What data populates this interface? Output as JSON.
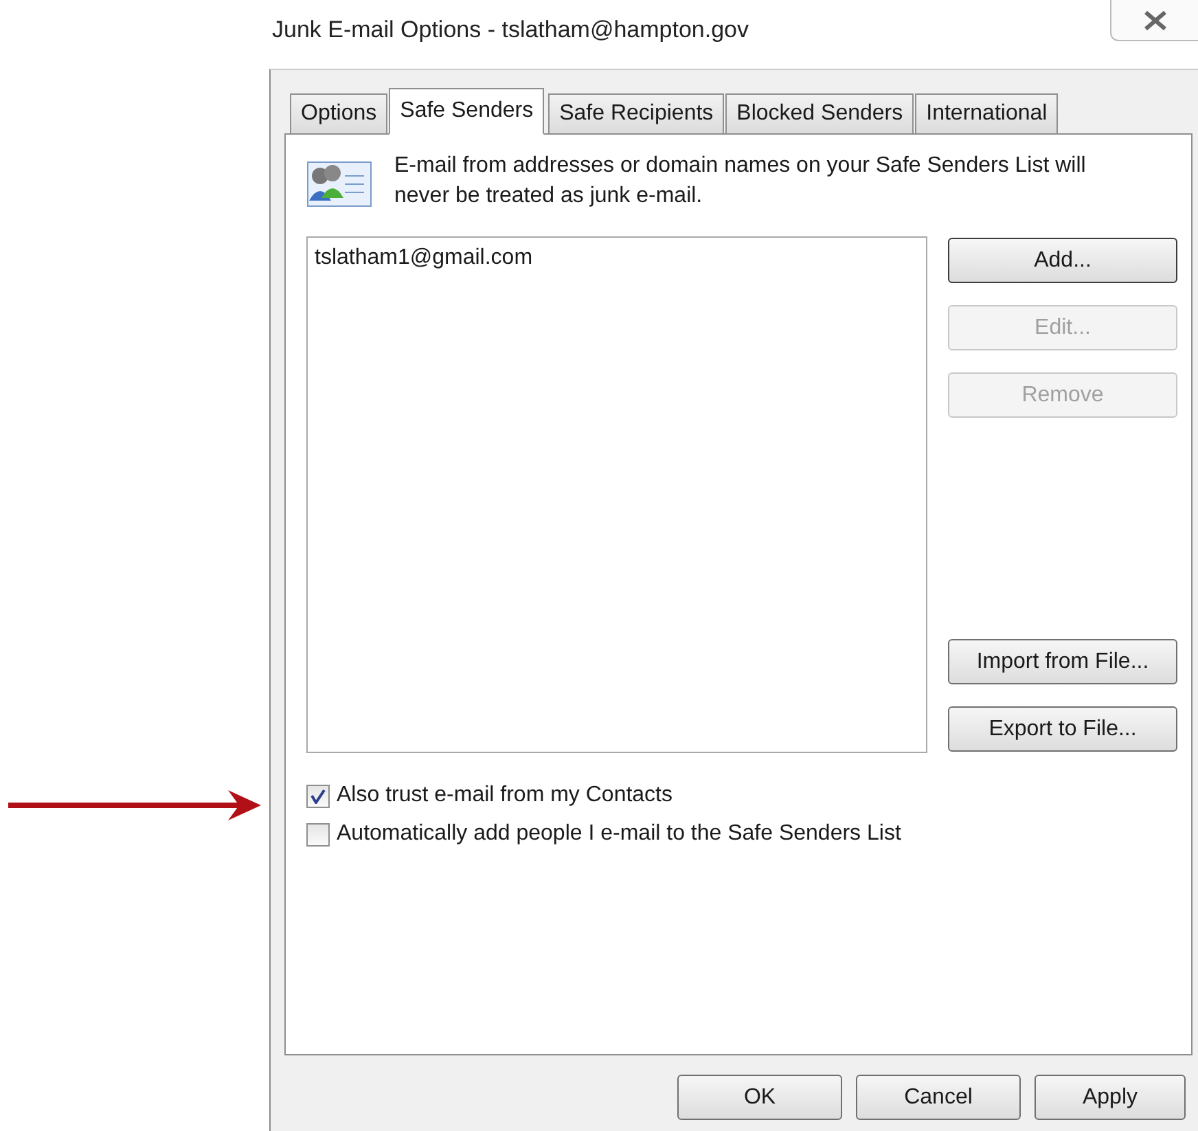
{
  "window": {
    "title": "Junk E-mail Options - tslatham@hampton.gov"
  },
  "tabs": [
    {
      "label": "Options",
      "selected": false
    },
    {
      "label": "Safe Senders",
      "selected": true
    },
    {
      "label": "Safe Recipients",
      "selected": false
    },
    {
      "label": "Blocked Senders",
      "selected": false
    },
    {
      "label": "International",
      "selected": false
    }
  ],
  "description": "E-mail from addresses or domain names on your Safe Senders List will never be treated as junk e-mail.",
  "list": {
    "items": [
      "tslatham1@gmail.com"
    ]
  },
  "side_buttons_top": [
    {
      "label": "Add...",
      "disabled": false,
      "default": true
    },
    {
      "label": "Edit...",
      "disabled": true,
      "default": false
    },
    {
      "label": "Remove",
      "disabled": true,
      "default": false
    }
  ],
  "side_buttons_bottom": [
    {
      "label": "Import from File...",
      "disabled": false,
      "default": false
    },
    {
      "label": "Export to File...",
      "disabled": false,
      "default": false
    }
  ],
  "checkboxes": [
    {
      "label": "Also trust e-mail from my Contacts",
      "checked": true
    },
    {
      "label": "Automatically add people I e-mail to the Safe Senders List",
      "checked": false
    }
  ],
  "footer_buttons": [
    {
      "label": "OK"
    },
    {
      "label": "Cancel"
    },
    {
      "label": "Apply"
    }
  ]
}
